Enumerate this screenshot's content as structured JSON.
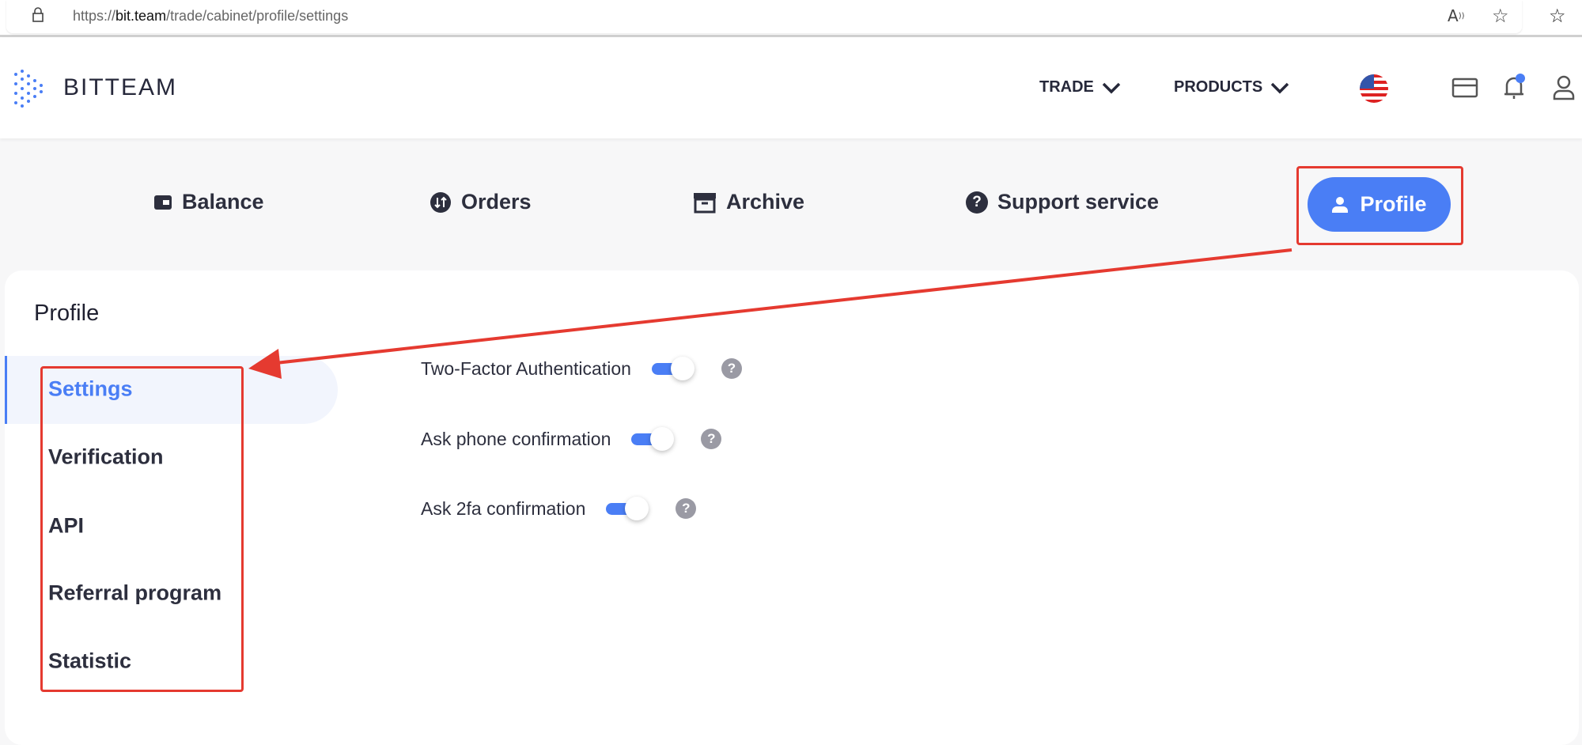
{
  "browser": {
    "url_prefix": "https://",
    "url_domain": "bit.team",
    "url_path": "/trade/cabinet/profile/settings"
  },
  "header": {
    "logo": "BITTEAM",
    "nav": [
      {
        "label": "TRADE"
      },
      {
        "label": "PRODUCTS"
      }
    ],
    "icons": [
      "us-flag-icon",
      "card-icon",
      "bell-icon",
      "user-icon"
    ],
    "accent": "#4a7ef5"
  },
  "tabs": [
    {
      "label": "Balance",
      "icon": "wallet-icon"
    },
    {
      "label": "Orders",
      "icon": "orders-icon"
    },
    {
      "label": "Archive",
      "icon": "archive-icon"
    },
    {
      "label": "Support service",
      "icon": "question-icon"
    },
    {
      "label": "Profile",
      "icon": "user-icon",
      "active": true
    }
  ],
  "profile": {
    "title": "Profile",
    "sidebar": [
      {
        "label": "Settings",
        "active": true
      },
      {
        "label": "Verification"
      },
      {
        "label": "API"
      },
      {
        "label": "Referral program"
      },
      {
        "label": "Statistic"
      }
    ],
    "settings": [
      {
        "label": "Two-Factor Authentication",
        "enabled": true
      },
      {
        "label": "Ask phone confirmation",
        "enabled": true
      },
      {
        "label": "Ask 2fa confirmation",
        "enabled": true
      }
    ]
  },
  "annotation_color": "#e53a30"
}
